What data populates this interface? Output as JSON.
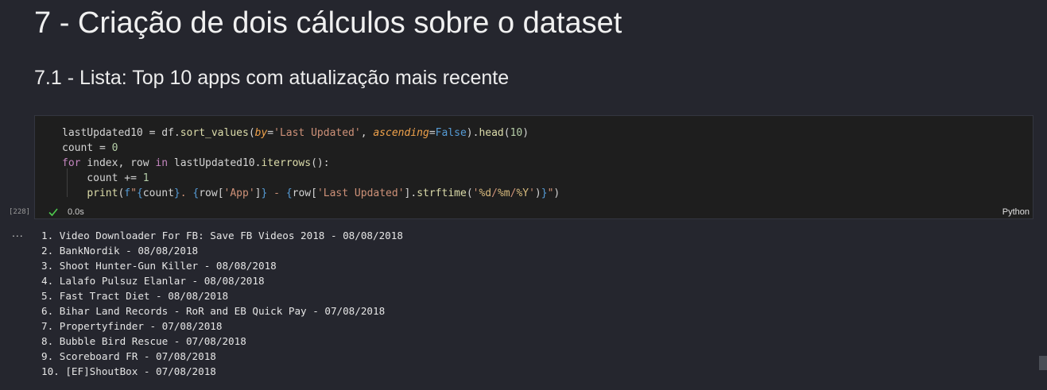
{
  "heading1": "7 - Criação de dois cálculos sobre o dataset",
  "heading2": "7.1 - Lista: Top 10 apps com atualização mais recente",
  "cell": {
    "exec_count": "[228]",
    "exec_status_icon": "check-icon",
    "exec_time": "0.0s",
    "language": "Python",
    "code_lines": [
      "lastUpdated10 = df.sort_values(by='Last Updated', ascending=False).head(10)",
      "count = 0",
      "for index, row in lastUpdated10.iterrows():",
      "    count += 1",
      "    print(f\"{count}. {row['App']} - {row['Last Updated'].strftime('%d/%m/%Y')}\")"
    ]
  },
  "output": {
    "more_icon": "...",
    "lines": [
      "1. Video Downloader For FB: Save FB Videos 2018 - 08/08/2018",
      "2. BankNordik - 08/08/2018",
      "3. Shoot Hunter-Gun Killer - 08/08/2018",
      "4. Lalafo Pulsuz Elanlar - 08/08/2018",
      "5. Fast Tract Diet - 08/08/2018",
      "6. Bihar Land Records - RoR and EB Quick Pay - 07/08/2018",
      "7. Propertyfinder - 07/08/2018",
      "8. Bubble Bird Rescue - 07/08/2018",
      "9. Scoreboard FR - 07/08/2018",
      "10. [EF]ShoutBox - 07/08/2018"
    ]
  },
  "colors": {
    "background": "#25262e",
    "code_background": "#1e1e1e",
    "success": "#4ec94e"
  }
}
